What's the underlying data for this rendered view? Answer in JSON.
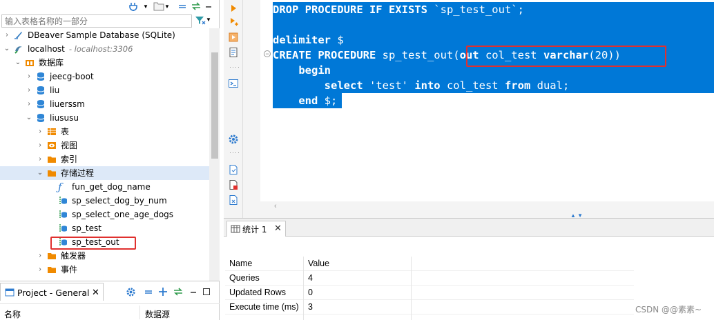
{
  "navigator": {
    "filter_placeholder": "输入表格名称的一部分",
    "tree": [
      {
        "label": "DBeaver Sample Database (SQLite)",
        "sub": "",
        "icon": "sqlite-db-icon",
        "expanded": false
      },
      {
        "label": "localhost",
        "sub": "- localhost:3306",
        "icon": "mysql-server-icon",
        "expanded": true
      },
      {
        "label": "数据库",
        "sub": "",
        "icon": "databases-folder-icon",
        "expanded": true
      },
      {
        "label": "jeecg-boot",
        "sub": "",
        "icon": "database-icon",
        "expanded": false
      },
      {
        "label": "liu",
        "sub": "",
        "icon": "database-icon",
        "expanded": false
      },
      {
        "label": "liuerssm",
        "sub": "",
        "icon": "database-icon",
        "expanded": false
      },
      {
        "label": "liususu",
        "sub": "",
        "icon": "database-icon",
        "expanded": true
      },
      {
        "label": "表",
        "sub": "",
        "icon": "tables-folder-icon",
        "expanded": false
      },
      {
        "label": "视图",
        "sub": "",
        "icon": "views-folder-icon",
        "expanded": false
      },
      {
        "label": "索引",
        "sub": "",
        "icon": "folder-icon",
        "expanded": false
      },
      {
        "label": "存储过程",
        "sub": "",
        "icon": "folder-icon",
        "expanded": true
      },
      {
        "label": "fun_get_dog_name",
        "sub": "",
        "icon": "function-icon",
        "expanded": false
      },
      {
        "label": "sp_select_dog_by_num",
        "sub": "",
        "icon": "procedure-icon",
        "expanded": false
      },
      {
        "label": "sp_select_one_age_dogs",
        "sub": "",
        "icon": "procedure-icon",
        "expanded": false
      },
      {
        "label": "sp_test",
        "sub": "",
        "icon": "procedure-icon",
        "expanded": false
      },
      {
        "label": "sp_test_out",
        "sub": "",
        "icon": "procedure-icon",
        "expanded": false
      },
      {
        "label": "触发器",
        "sub": "",
        "icon": "folder-icon",
        "expanded": false
      },
      {
        "label": "事件",
        "sub": "",
        "icon": "folder-icon",
        "expanded": false
      }
    ]
  },
  "project": {
    "tab_label": "Project - General",
    "col_name": "名称",
    "col_datasource": "数据源"
  },
  "editor": {
    "lines": [
      "DROP PROCEDURE IF EXISTS `sp_test_out`;",
      "",
      "delimiter $",
      "CREATE PROCEDURE sp_test_out(out col_test varchar(20))",
      "    begin",
      "        select 'test' into col_test from dual;",
      "    end $;"
    ]
  },
  "results": {
    "tab_label": "统计 1",
    "headers": {
      "name": "Name",
      "value": "Value"
    },
    "rows": [
      {
        "name": "Queries",
        "value": "4"
      },
      {
        "name": "Updated Rows",
        "value": "0"
      },
      {
        "name": "Execute time (ms)",
        "value": "3"
      }
    ]
  },
  "watermark": "CSDN @@素素~",
  "colors": {
    "selection": "#0078d7",
    "highlight_box": "#e0302e",
    "tree_selected": "#dde9f8"
  }
}
